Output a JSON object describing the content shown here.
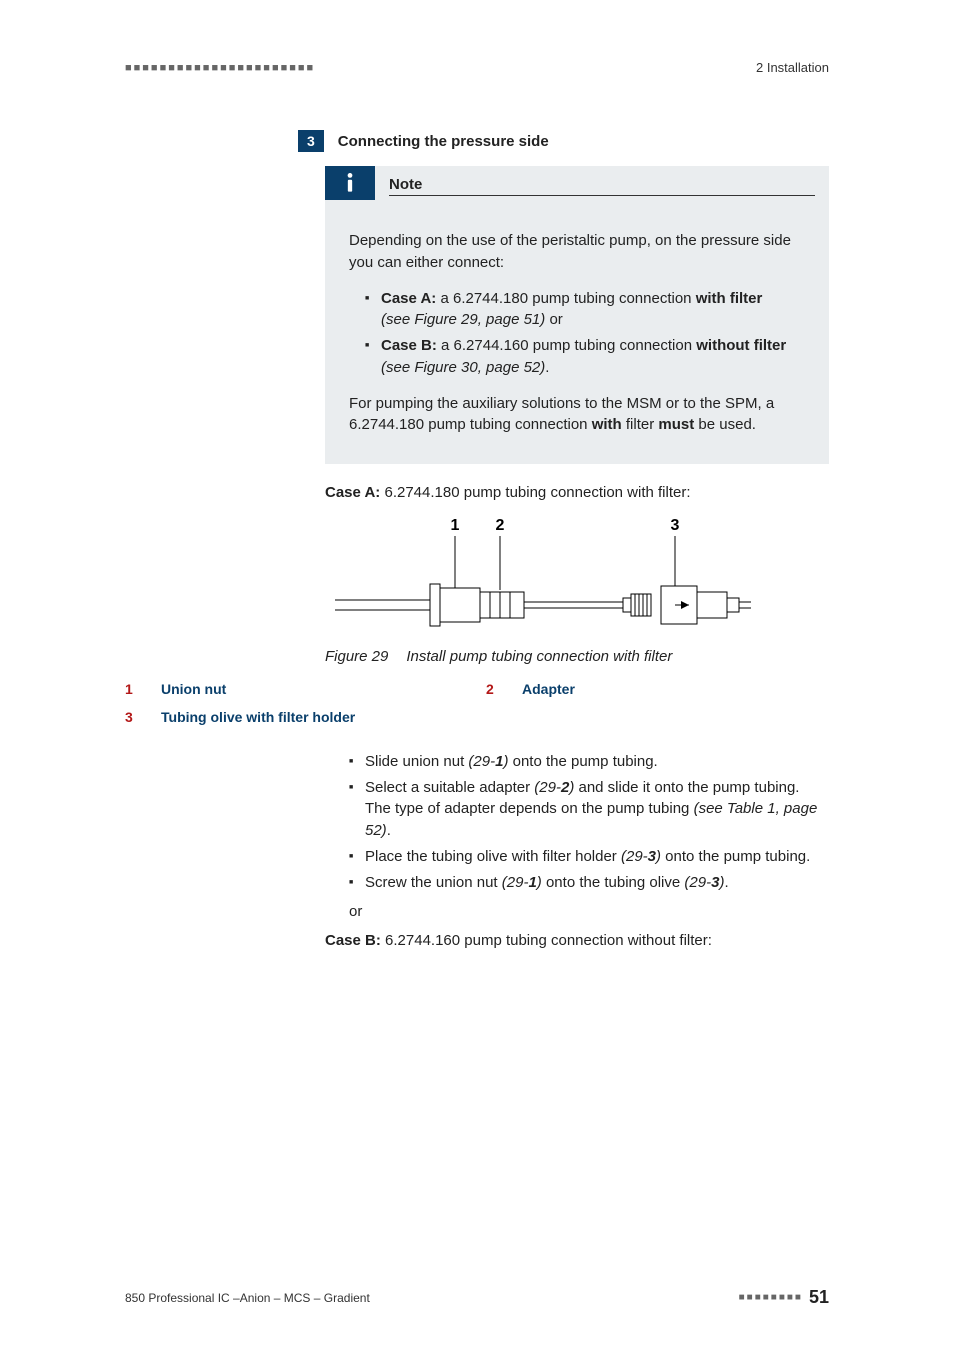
{
  "header": {
    "left_dashes": "■■■■■■■■■■■■■■■■■■■■■■",
    "chapter": "2 Installation"
  },
  "step": {
    "num": "3",
    "title": "Connecting the pressure side"
  },
  "note": {
    "title": "Note",
    "intro": "Depending on the use of the peristaltic pump, on the pressure side you can either connect:",
    "case_a_pre": "Case A:",
    "case_a_mid": " a 6.2744.180 pump tubing connection ",
    "case_a_bold": "with filter",
    "case_a_ref": "(see Figure 29, page 51)",
    "case_a_post": " or",
    "case_b_pre": "Case B:",
    "case_b_mid": " a 6.2744.160 pump tubing connection ",
    "case_b_bold": "without filter",
    "case_b_ref": "(see Figure 30, page 52)",
    "case_b_post": ".",
    "closing_a": "For pumping the auxiliary solutions to the MSM or to the SPM, a 6.2744.180 pump tubing connection ",
    "closing_with": "with",
    "closing_b": " filter ",
    "closing_must": "must",
    "closing_c": " be used."
  },
  "case_a_line": {
    "label": "Case A:",
    "text": " 6.2744.180 pump tubing connection with filter:"
  },
  "figure": {
    "label": "Figure 29",
    "caption": "Install pump tubing connection with filter",
    "markers": {
      "m1": "1",
      "m2": "2",
      "m3": "3"
    }
  },
  "legend": {
    "n1": "1",
    "t1": "Union nut",
    "n2": "2",
    "t2": "Adapter",
    "n3": "3",
    "t3": "Tubing olive with filter holder"
  },
  "steps": {
    "s1a": "Slide union nut ",
    "s1ref": "(29-",
    "s1num": "1",
    "s1b": ")",
    "s1c": " onto the pump tubing.",
    "s2a": "Select a suitable adapter ",
    "s2ref": "(29-",
    "s2num": "2",
    "s2b": ")",
    "s2c": " and slide it onto the pump tubing. The type of adapter depends on the pump tubing ",
    "s2ref2": "(see Table 1, page 52)",
    "s2d": ".",
    "s3a": "Place the tubing olive with filter holder ",
    "s3ref": "(29-",
    "s3num": "3",
    "s3b": ")",
    "s3c": " onto the pump tubing.",
    "s4a": "Screw the union nut ",
    "s4ref1": "(29-",
    "s4num1": "1",
    "s4b1": ")",
    "s4c": " onto the tubing olive ",
    "s4ref2": "(29-",
    "s4num2": "3",
    "s4b2": ")",
    "s4d": "."
  },
  "or": "or",
  "case_b_line": {
    "label": "Case B:",
    "text": " 6.2744.160 pump tubing connection without filter:"
  },
  "footer": {
    "left": "850 Professional IC –Anion – MCS – Gradient",
    "dashes": "■■■■■■■■",
    "page": "51"
  }
}
